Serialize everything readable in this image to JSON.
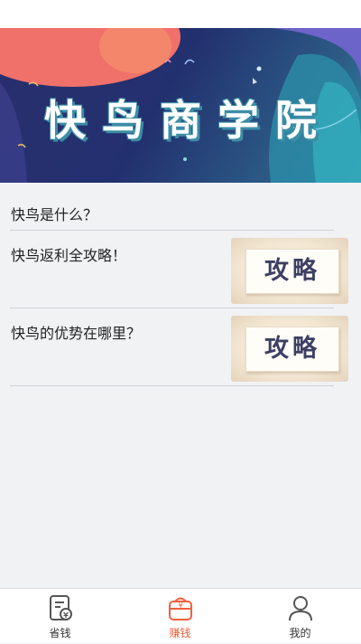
{
  "banner": {
    "title": "快鸟商学院"
  },
  "articles": [
    {
      "title": "快鸟是什么？",
      "has_thumb": false
    },
    {
      "title": "快鸟返利全攻略！",
      "has_thumb": true,
      "thumb_text": "攻略"
    },
    {
      "title": "快鸟的优势在哪里？",
      "has_thumb": true,
      "thumb_text": "攻略"
    }
  ],
  "tabbar": {
    "items": [
      {
        "label": "省钱",
        "icon": "save-money-icon",
        "active": false
      },
      {
        "label": "赚钱",
        "icon": "earn-money-bag-icon",
        "active": true
      },
      {
        "label": "我的",
        "icon": "user-profile-icon",
        "active": false
      }
    ],
    "active_color": "#f0603c"
  }
}
